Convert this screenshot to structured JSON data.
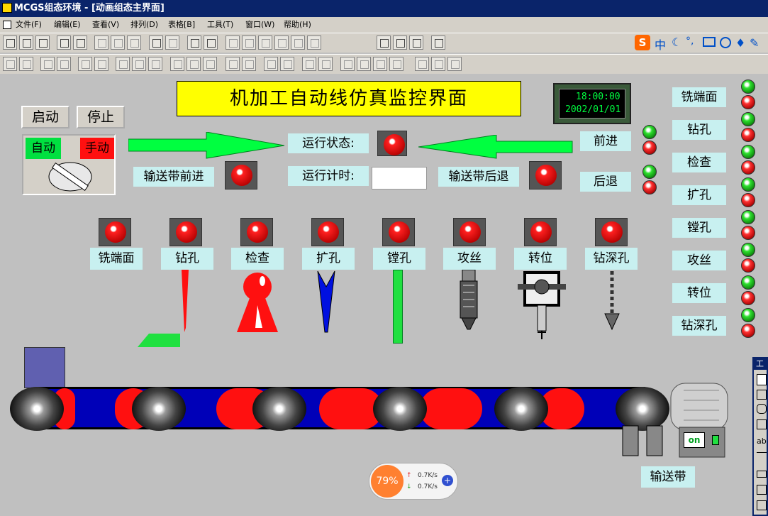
{
  "window": {
    "title": "MCGS组态环境 - [动画组态主界面]"
  },
  "menu": [
    "文件(F)",
    "编辑(E)",
    "查看(V)",
    "排列(D)",
    "表格[B]",
    "工具(T)",
    "窗口(W)",
    "帮助(H)"
  ],
  "ime": {
    "lang": "中"
  },
  "header": {
    "title": "机加工自动线仿真监控界面",
    "time": "18:00:00",
    "date": "2002/01/01"
  },
  "controls": {
    "start": "启动",
    "stop": "停止",
    "auto": "自动",
    "manual": "手动"
  },
  "status": {
    "running_state": "运行状态:",
    "running_time": "运行计时:",
    "timer_value": "",
    "forward_label": "输送带前进",
    "backward_label": "输送带后退",
    "fwd_btn": "前进",
    "back_btn": "后退"
  },
  "stations": [
    "铣端面",
    "钻孔",
    "检查",
    "扩孔",
    "镗孔",
    "攻丝",
    "转位",
    "钻深孔"
  ],
  "conveyor": {
    "label": "输送带",
    "motor_switch": "on"
  },
  "netmon": {
    "percent": "79%",
    "up": "0.7K/s",
    "down": "0.7K/s"
  },
  "toolbox": {
    "title": "工具",
    "text_tool": "ab"
  },
  "colors": {
    "title_bg": "#ffff00",
    "arrow": "#00ff40",
    "belt": "#0000c0",
    "led_red": "#ff2020",
    "label_bg": "#c8f0f0"
  }
}
